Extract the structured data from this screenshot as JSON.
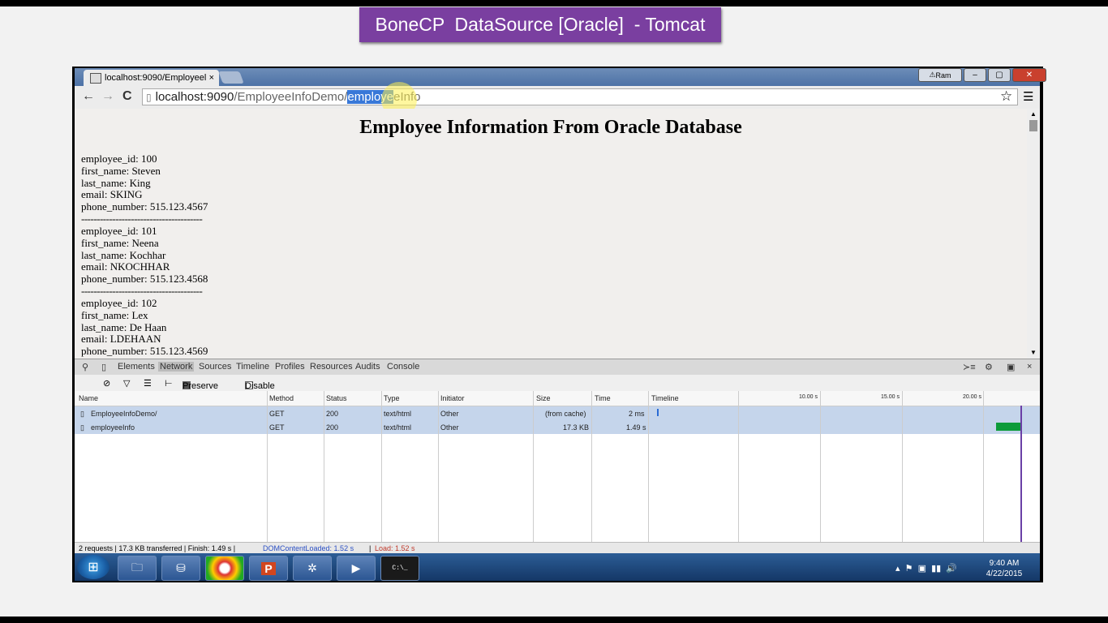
{
  "banner": {
    "title": "BoneCP  DataSource [Oracle]  - Tomcat"
  },
  "browser": {
    "tab_title": "localhost:9090/Employeel",
    "tab_close": "×",
    "user_label": "Ram",
    "window_controls": {
      "minimize": "–",
      "maximize": "▢",
      "close": "✕"
    },
    "back": "←",
    "forward": "→",
    "reload": "C",
    "url": {
      "host": "localhost:9090",
      "path": "/EmployeeInfoDemo/",
      "selected": "employe",
      "rest": "eInfo"
    }
  },
  "page": {
    "heading": "Employee Information From Oracle Database",
    "separator": "---------------------------------------",
    "employees": [
      {
        "id": "employee_id: 100",
        "first": "first_name: Steven",
        "last": "last_name: King",
        "email": "email: SKING",
        "phone": "phone_number: 515.123.4567"
      },
      {
        "id": "employee_id: 101",
        "first": "first_name: Neena",
        "last": "last_name: Kochhar",
        "email": "email: NKOCHHAR",
        "phone": "phone_number: 515.123.4568"
      },
      {
        "id": "employee_id: 102",
        "first": "first_name: Lex",
        "last": "last_name: De Haan",
        "email": "email: LDEHAAN",
        "phone": "phone_number: 515.123.4569"
      }
    ]
  },
  "devtools": {
    "tabs": [
      "Elements",
      "Network",
      "Sources",
      "Timeline",
      "Profiles",
      "Resources",
      "Audits",
      "Console"
    ],
    "active_tab": "Network",
    "preserve_log": "Preserve log",
    "disable_cache": "Disable cache",
    "columns": [
      "Name",
      "Method",
      "Status",
      "Type",
      "Initiator",
      "Size",
      "Time",
      "Timeline"
    ],
    "timeline_ticks": [
      "10.00 s",
      "15.00 s",
      "20.00 s"
    ],
    "rows": [
      {
        "name": "EmployeeInfoDemo/",
        "method": "GET",
        "status": "200",
        "type": "text/html",
        "initiator": "Other",
        "size": "(from cache)",
        "time": "2 ms"
      },
      {
        "name": "employeeInfo",
        "method": "GET",
        "status": "200",
        "type": "text/html",
        "initiator": "Other",
        "size": "17.3 KB",
        "time": "1.49 s"
      }
    ],
    "status": {
      "summary": "2 requests  |  17.3 KB transferred  |  Finish: 1.49 s  |",
      "dom": "DOMContentLoaded: 1.52 s",
      "sep": "|",
      "load": "Load: 1.52 s",
      "dom_color": "#2a4fc4",
      "load_color": "#c0392b"
    }
  },
  "taskbar": {
    "apps": [
      "folder-icon",
      "network-icon",
      "chrome-icon",
      "powerpoint-icon",
      "app-icon",
      "media-icon",
      "cmd-icon"
    ],
    "cmd_label": "C:\\_",
    "time": "9:40 AM",
    "date": "4/22/2015"
  }
}
